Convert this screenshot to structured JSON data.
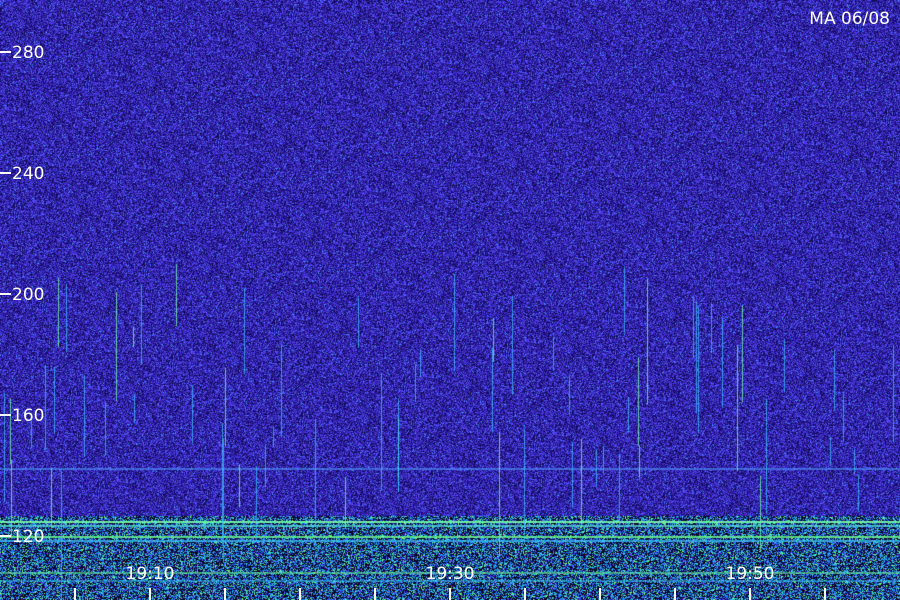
{
  "chart_data": {
    "type": "heatmap",
    "label": "MA 06/08",
    "y_ticks": [
      120,
      160,
      200,
      240,
      280
    ],
    "y_range": [
      107,
      290
    ],
    "x_ticks": [
      "19:10",
      "19:30",
      "19:50"
    ],
    "x_minor_ticks_per_major": 2,
    "colors": {
      "background": "#2a1d88",
      "noise": "#4a3af0",
      "signal": "#33ccff",
      "strong": "#66ff99",
      "text": "#ffffff"
    }
  }
}
